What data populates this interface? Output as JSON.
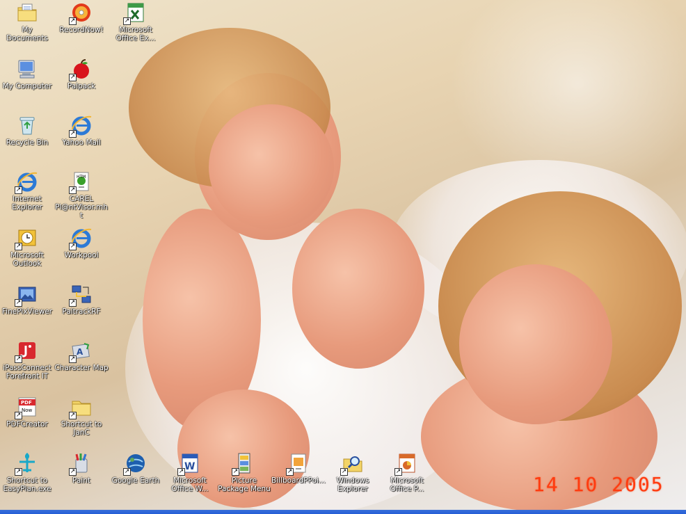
{
  "desktop": {
    "icons": [
      {
        "label": "My Documents",
        "icon": "folder-documents-icon",
        "shortcut": false
      },
      {
        "label": "RecordNow!",
        "icon": "cd-record-icon",
        "shortcut": true
      },
      {
        "label": "Microsoft Office Ex...",
        "icon": "excel-icon",
        "shortcut": true
      },
      {
        "label": "My Computer",
        "icon": "computer-icon",
        "shortcut": false
      },
      {
        "label": "Palpack",
        "icon": "apple-icon",
        "shortcut": true
      },
      {
        "label": "Recycle Bin",
        "icon": "recycle-bin-icon",
        "shortcut": false
      },
      {
        "label": "Yahoo Mail",
        "icon": "internet-explorer-icon",
        "shortcut": true
      },
      {
        "label": "Internet Explorer",
        "icon": "internet-explorer-icon",
        "shortcut": true
      },
      {
        "label": "CAREL Pl@ntVisor.mht",
        "icon": "web-document-icon",
        "shortcut": true
      },
      {
        "label": "Microsoft Outlook",
        "icon": "outlook-icon",
        "shortcut": true
      },
      {
        "label": "Workpool",
        "icon": "internet-explorer-icon",
        "shortcut": true
      },
      {
        "label": "FinePixViewer",
        "icon": "photo-viewer-icon",
        "shortcut": true
      },
      {
        "label": "PaltrackRF",
        "icon": "network-icon",
        "shortcut": true
      },
      {
        "label": "iPassConnect Forefront IT",
        "icon": "ipass-icon",
        "shortcut": true
      },
      {
        "label": "Character Map",
        "icon": "character-map-icon",
        "shortcut": true
      },
      {
        "label": "PDFCreator",
        "icon": "pdf-icon",
        "shortcut": true
      },
      {
        "label": "Shortcut to JanC",
        "icon": "folder-icon",
        "shortcut": true
      },
      {
        "label": "Shortcut to EasyPlan.exe",
        "icon": "airplane-icon",
        "shortcut": true
      },
      {
        "label": "Paint",
        "icon": "paint-icon",
        "shortcut": true
      },
      {
        "label": "Google Earth",
        "icon": "globe-icon",
        "shortcut": true
      },
      {
        "label": "Microsoft Office W...",
        "icon": "word-icon",
        "shortcut": true
      },
      {
        "label": "Picture Package Menu",
        "icon": "picture-package-icon",
        "shortcut": true
      },
      {
        "label": "BillboardPPoi...",
        "icon": "billboard-icon",
        "shortcut": true
      },
      {
        "label": "Windows Explorer",
        "icon": "explorer-icon",
        "shortcut": true
      },
      {
        "label": "Microsoft Office P...",
        "icon": "powerpoint-icon",
        "shortcut": true
      }
    ]
  },
  "wallpaper": {
    "datestamp": "14 10 2005"
  },
  "colors": {
    "label_text": "#ffffff",
    "datestamp": "#ff3b10",
    "taskbar": "#245dd7"
  }
}
